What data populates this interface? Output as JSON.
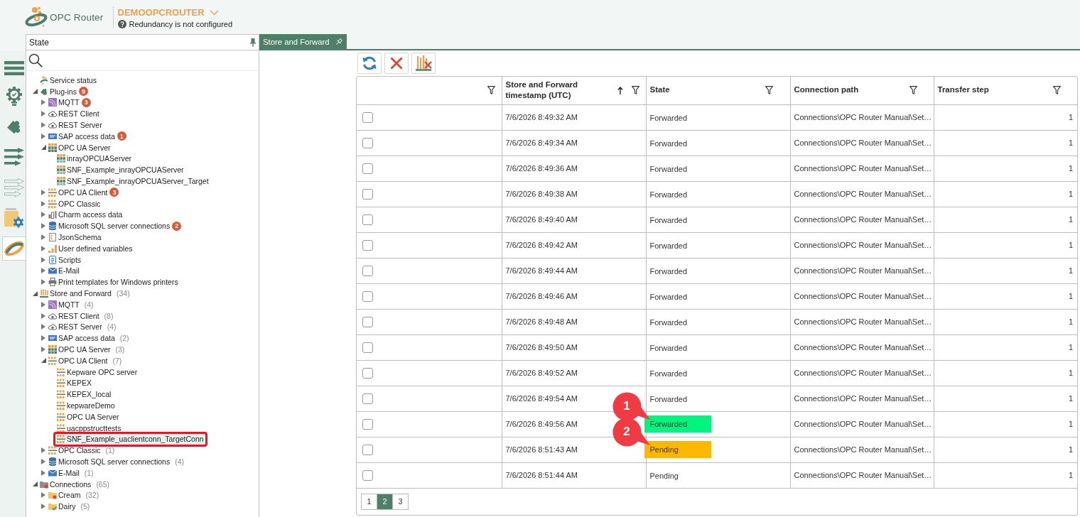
{
  "header": {
    "logo_text": "OPC Router",
    "server_name": "DEMOOPCROUTER",
    "redundancy": "Redundancy is not configured"
  },
  "sidebar": {
    "items": [
      {
        "kind": "menu",
        "selected": false
      },
      {
        "kind": "status",
        "selected": false
      },
      {
        "kind": "plugins",
        "selected": false
      },
      {
        "kind": "connections",
        "selected": false
      },
      {
        "kind": "templates",
        "selected": false
      },
      {
        "kind": "configuration",
        "selected": false
      },
      {
        "kind": "logo",
        "selected": true
      }
    ]
  },
  "state_panel": {
    "title": "State",
    "tree": [
      {
        "label": "Service status",
        "kind": "service",
        "selected": false
      },
      {
        "label": "Plug-ins",
        "kind": "plugins",
        "expanded": true,
        "selected": false,
        "badge": "9",
        "children": [
          {
            "label": "MQTT",
            "kind": "mqtt",
            "expanded": false,
            "selected": false,
            "badge": "3"
          },
          {
            "label": "REST Client",
            "kind": "rest",
            "expanded": false,
            "selected": false
          },
          {
            "label": "REST Server",
            "kind": "rest",
            "expanded": false,
            "selected": false
          },
          {
            "label": "SAP access data",
            "kind": "sap",
            "expanded": false,
            "selected": false,
            "badge": "1"
          },
          {
            "label": "OPC UA Server",
            "kind": "uaserver",
            "expanded": true,
            "selected": false,
            "children": [
              {
                "label": "inrayOPCUAServer",
                "kind": "uaitem",
                "selected": false
              },
              {
                "label": "SNF_Example_inrayOPCUAServer",
                "kind": "uaitem",
                "selected": false
              },
              {
                "label": "SNF_Example_inrayOPCUAServer_Target",
                "kind": "uaitem",
                "selected": false
              }
            ]
          },
          {
            "label": "OPC UA Client",
            "kind": "uaclient",
            "expanded": false,
            "selected": false,
            "badge": "3"
          },
          {
            "label": "OPC Classic",
            "kind": "uaclient",
            "expanded": false,
            "selected": false
          },
          {
            "label": "Charm access data",
            "kind": "charm",
            "expanded": false,
            "selected": false
          },
          {
            "label": "Microsoft SQL server connections",
            "kind": "sql",
            "expanded": false,
            "selected": false,
            "badge": "2"
          },
          {
            "label": "JsonSchema",
            "kind": "json",
            "expanded": false,
            "selected": false
          },
          {
            "label": "User defined variables",
            "kind": "variables",
            "expanded": false,
            "selected": false
          },
          {
            "label": "Scripts",
            "kind": "scripts",
            "expanded": false,
            "selected": false
          },
          {
            "label": "E-Mail",
            "kind": "email",
            "expanded": false,
            "selected": false
          },
          {
            "label": "Print templates for Windows printers",
            "kind": "print",
            "expanded": false,
            "selected": false
          }
        ]
      },
      {
        "label": "Store and Forward",
        "kind": "store",
        "expanded": true,
        "selected": false,
        "count": "(34)",
        "children": [
          {
            "label": "MQTT",
            "kind": "mqtt",
            "expanded": false,
            "selected": false,
            "count": "(4)"
          },
          {
            "label": "REST Client",
            "kind": "rest",
            "expanded": false,
            "selected": false,
            "count": "(8)"
          },
          {
            "label": "REST Server",
            "kind": "rest",
            "expanded": false,
            "selected": false,
            "count": "(4)"
          },
          {
            "label": "SAP access data",
            "kind": "sap",
            "expanded": false,
            "selected": false,
            "count": "(2)"
          },
          {
            "label": "OPC UA Server",
            "kind": "uaserver",
            "expanded": false,
            "selected": false,
            "count": "(3)"
          },
          {
            "label": "OPC UA Client",
            "kind": "uaclient",
            "expanded": true,
            "selected": false,
            "count": "(7)",
            "children": [
              {
                "label": "Kepware OPC server",
                "kind": "uaclient",
                "selected": false
              },
              {
                "label": "KEPEX",
                "kind": "uaclient",
                "selected": false
              },
              {
                "label": "KEPEX_local",
                "kind": "uaclient",
                "selected": false
              },
              {
                "label": "kepwareDemo",
                "kind": "uaclient",
                "selected": false
              },
              {
                "label": "OPC UA Server",
                "kind": "uaclient",
                "selected": false
              },
              {
                "label": "uacppstructtests",
                "kind": "uaclient",
                "selected": false
              },
              {
                "label": "SNF_Example_uaclientconn_TargetConn",
                "kind": "uaclient",
                "selected": true,
                "highlighted": true
              }
            ]
          },
          {
            "label": "OPC Classic",
            "kind": "uaclient",
            "expanded": false,
            "selected": false,
            "count": "(1)"
          },
          {
            "label": "Microsoft SQL server connections",
            "kind": "sql",
            "expanded": false,
            "selected": false,
            "count": "(4)"
          },
          {
            "label": "E-Mail",
            "kind": "email",
            "expanded": false,
            "selected": false,
            "count": "(1)"
          }
        ]
      },
      {
        "label": "Connections",
        "kind": "connections",
        "expanded": true,
        "selected": false,
        "count": "(65)",
        "children": [
          {
            "label": "Cream",
            "kind": "folderstop",
            "expanded": false,
            "selected": false,
            "count": "(32)"
          },
          {
            "label": "Dairy",
            "kind": "foldercheck",
            "expanded": false,
            "selected": false,
            "count": "(5)"
          }
        ]
      }
    ]
  },
  "tabs": [
    {
      "label": "Store and Forward",
      "selected": true
    }
  ],
  "table": {
    "columns": [
      {
        "kind": "text",
        "label": "Store and Forward timestamp (UTC)",
        "sorted": true
      },
      {
        "kind": "state",
        "label": "State",
        "sorted": false
      },
      {
        "kind": "text",
        "label": "Connection path",
        "sorted": false
      },
      {
        "kind": "number",
        "label": "Transfer step",
        "sorted": false
      }
    ],
    "rows": [
      {
        "checked": false,
        "cells": [
          "7/6/2026 8:49:32 AM",
          "Forwarded",
          "Connections\\OPC Router Manual\\Set…",
          "1"
        ]
      },
      {
        "checked": false,
        "cells": [
          "7/6/2026 8:49:34 AM",
          "Forwarded",
          "Connections\\OPC Router Manual\\Set…",
          "1"
        ]
      },
      {
        "checked": false,
        "cells": [
          "7/6/2026 8:49:36 AM",
          "Forwarded",
          "Connections\\OPC Router Manual\\Set…",
          "1"
        ]
      },
      {
        "checked": false,
        "cells": [
          "7/6/2026 8:49:38 AM",
          "Forwarded",
          "Connections\\OPC Router Manual\\Set…",
          "1"
        ]
      },
      {
        "checked": false,
        "cells": [
          "7/6/2026 8:49:40 AM",
          "Forwarded",
          "Connections\\OPC Router Manual\\Set…",
          "1"
        ]
      },
      {
        "checked": false,
        "cells": [
          "7/6/2026 8:49:42 AM",
          "Forwarded",
          "Connections\\OPC Router Manual\\Set…",
          "1"
        ]
      },
      {
        "checked": false,
        "cells": [
          "7/6/2026 8:49:44 AM",
          "Forwarded",
          "Connections\\OPC Router Manual\\Set…",
          "1"
        ]
      },
      {
        "checked": false,
        "cells": [
          "7/6/2026 8:49:46 AM",
          "Forwarded",
          "Connections\\OPC Router Manual\\Set…",
          "1"
        ]
      },
      {
        "checked": false,
        "cells": [
          "7/6/2026 8:49:48 AM",
          "Forwarded",
          "Connections\\OPC Router Manual\\Set…",
          "1"
        ]
      },
      {
        "checked": false,
        "cells": [
          "7/6/2026 8:49:50 AM",
          "Forwarded",
          "Connections\\OPC Router Manual\\Set…",
          "1"
        ]
      },
      {
        "checked": false,
        "cells": [
          "7/6/2026 8:49:52 AM",
          "Forwarded",
          "Connections\\OPC Router Manual\\Set…",
          "1"
        ]
      },
      {
        "checked": false,
        "cells": [
          "7/6/2026 8:49:54 AM",
          "Forwarded",
          "Connections\\OPC Router Manual\\Set…",
          "1"
        ]
      },
      {
        "checked": false,
        "cells": [
          "7/6/2026 8:49:56 AM",
          "Forwarded",
          "Connections\\OPC Router Manual\\Set…",
          "1"
        ],
        "color": "#00f57f",
        "callout": "1"
      },
      {
        "checked": false,
        "cells": [
          "7/6/2026 8:51:43 AM",
          "Pending",
          "Connections\\OPC Router Manual\\Set…",
          "1"
        ],
        "color": "#ffb800",
        "callout": "2"
      },
      {
        "checked": false,
        "cells": [
          "7/6/2026 8:51:44 AM",
          "Pending",
          "Connections\\OPC Router Manual\\Set…",
          "1"
        ]
      }
    ],
    "pages": [
      {
        "label": "1",
        "selected": false
      },
      {
        "label": "2",
        "selected": true
      },
      {
        "label": "3",
        "selected": false
      }
    ]
  }
}
